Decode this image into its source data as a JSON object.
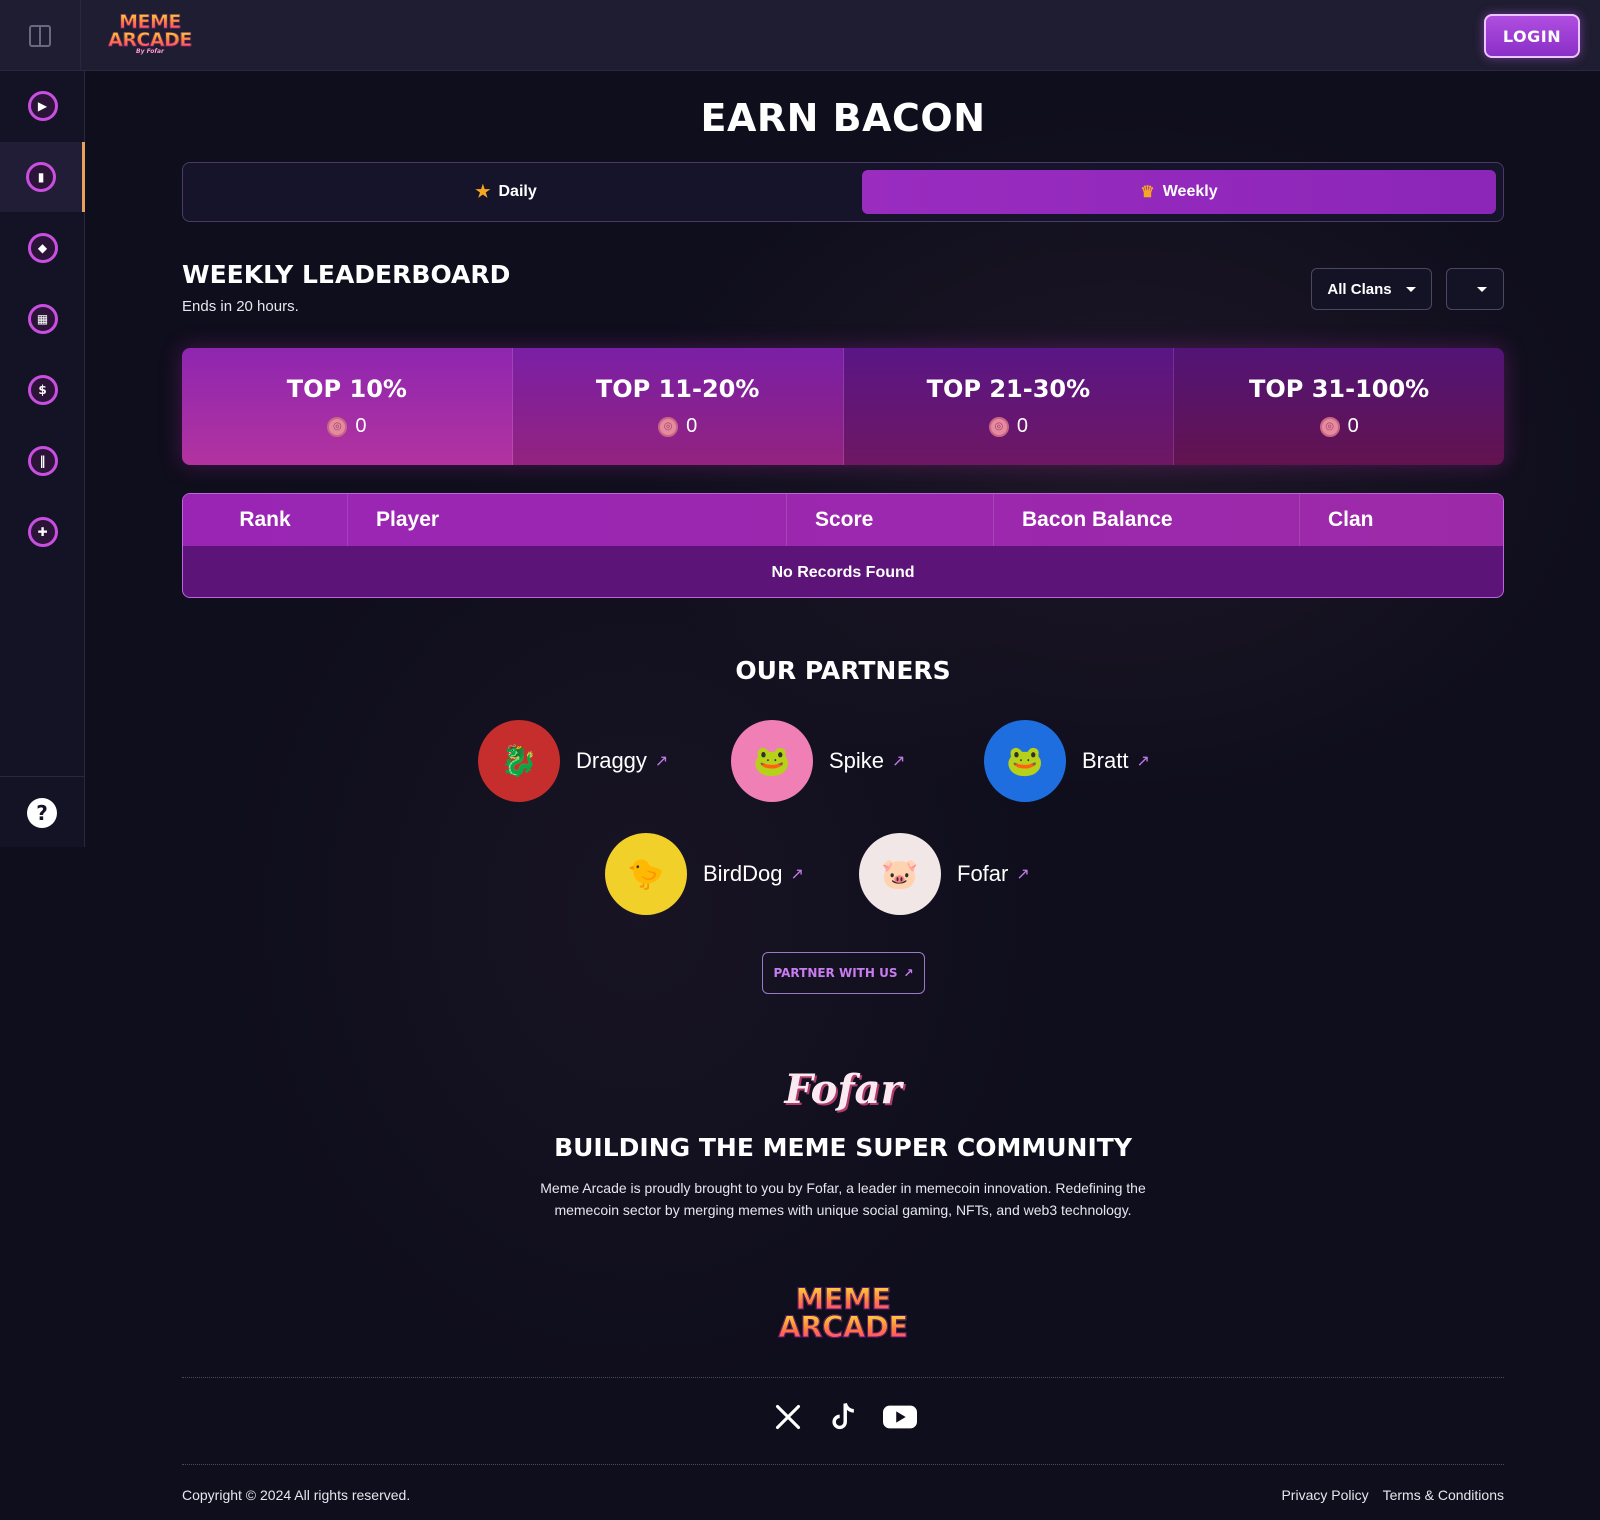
{
  "header": {
    "logo_line1": "MEME",
    "logo_line2": "ARCADE",
    "logo_tagline": "By Fofar",
    "login_label": "LOGIN"
  },
  "sidebar": {
    "items": [
      {
        "icon": "play-icon",
        "glyph": "▶"
      },
      {
        "icon": "leaderboard-icon",
        "glyph": "▮",
        "active": true
      },
      {
        "icon": "games-icon",
        "glyph": "◆"
      },
      {
        "icon": "shop-icon",
        "glyph": "▦"
      },
      {
        "icon": "dollar-icon",
        "glyph": "$"
      },
      {
        "icon": "pause-icon",
        "glyph": "‖"
      },
      {
        "icon": "ticket-icon",
        "glyph": "✚"
      }
    ],
    "help_glyph": "?"
  },
  "main": {
    "title": "EARN BACON",
    "tabs": [
      {
        "label": "Daily",
        "icon": "star-icon",
        "active": false
      },
      {
        "label": "Weekly",
        "icon": "crown-icon",
        "active": true
      }
    ],
    "leaderboard_title": "WEEKLY LEADERBOARD",
    "leaderboard_sub": "Ends in 20 hours.",
    "clan_filter": "All Clans",
    "period_filter": ""
  },
  "tiers": [
    {
      "name": "TOP 10%",
      "value": "0"
    },
    {
      "name": "TOP 11-20%",
      "value": "0"
    },
    {
      "name": "TOP 21-30%",
      "value": "0"
    },
    {
      "name": "TOP 31-100%",
      "value": "0"
    }
  ],
  "table": {
    "columns": [
      "Rank",
      "Player",
      "Score",
      "Bacon Balance",
      "Clan"
    ],
    "empty_message": "No Records Found"
  },
  "partners": {
    "title": "OUR PARTNERS",
    "items": [
      {
        "name": "Draggy",
        "color": "#c62d2d"
      },
      {
        "name": "Spike",
        "color": "#f07fb5"
      },
      {
        "name": "Bratt",
        "color": "#1f6ee0"
      },
      {
        "name": "BirdDog",
        "color": "#f2d02a"
      },
      {
        "name": "Fofar",
        "color": "#f2e7e7"
      }
    ],
    "cta": "PARTNER WITH US",
    "arrow": "↗"
  },
  "footer": {
    "script_logo": "Fofar",
    "tagline": "BUILDING THE MEME SUPER COMMUNITY",
    "about_line1": "Meme Arcade is proudly brought to you by Fofar, a leader in memecoin innovation. Redefining the",
    "about_line2": "memecoin sector by merging memes with unique social gaming, NFTs, and web3 technology.",
    "logo_line1": "MEME",
    "logo_line2": "ARCADE",
    "socials": [
      "x-icon",
      "tiktok-icon",
      "youtube-icon"
    ],
    "copyright": "Copyright © 2024 All rights reserved.",
    "privacy": "Privacy Policy",
    "terms": "Terms & Conditions"
  },
  "colors": {
    "accent": "#9a2cc0",
    "background": "#0f0e1c",
    "gold": "#f5a623"
  }
}
